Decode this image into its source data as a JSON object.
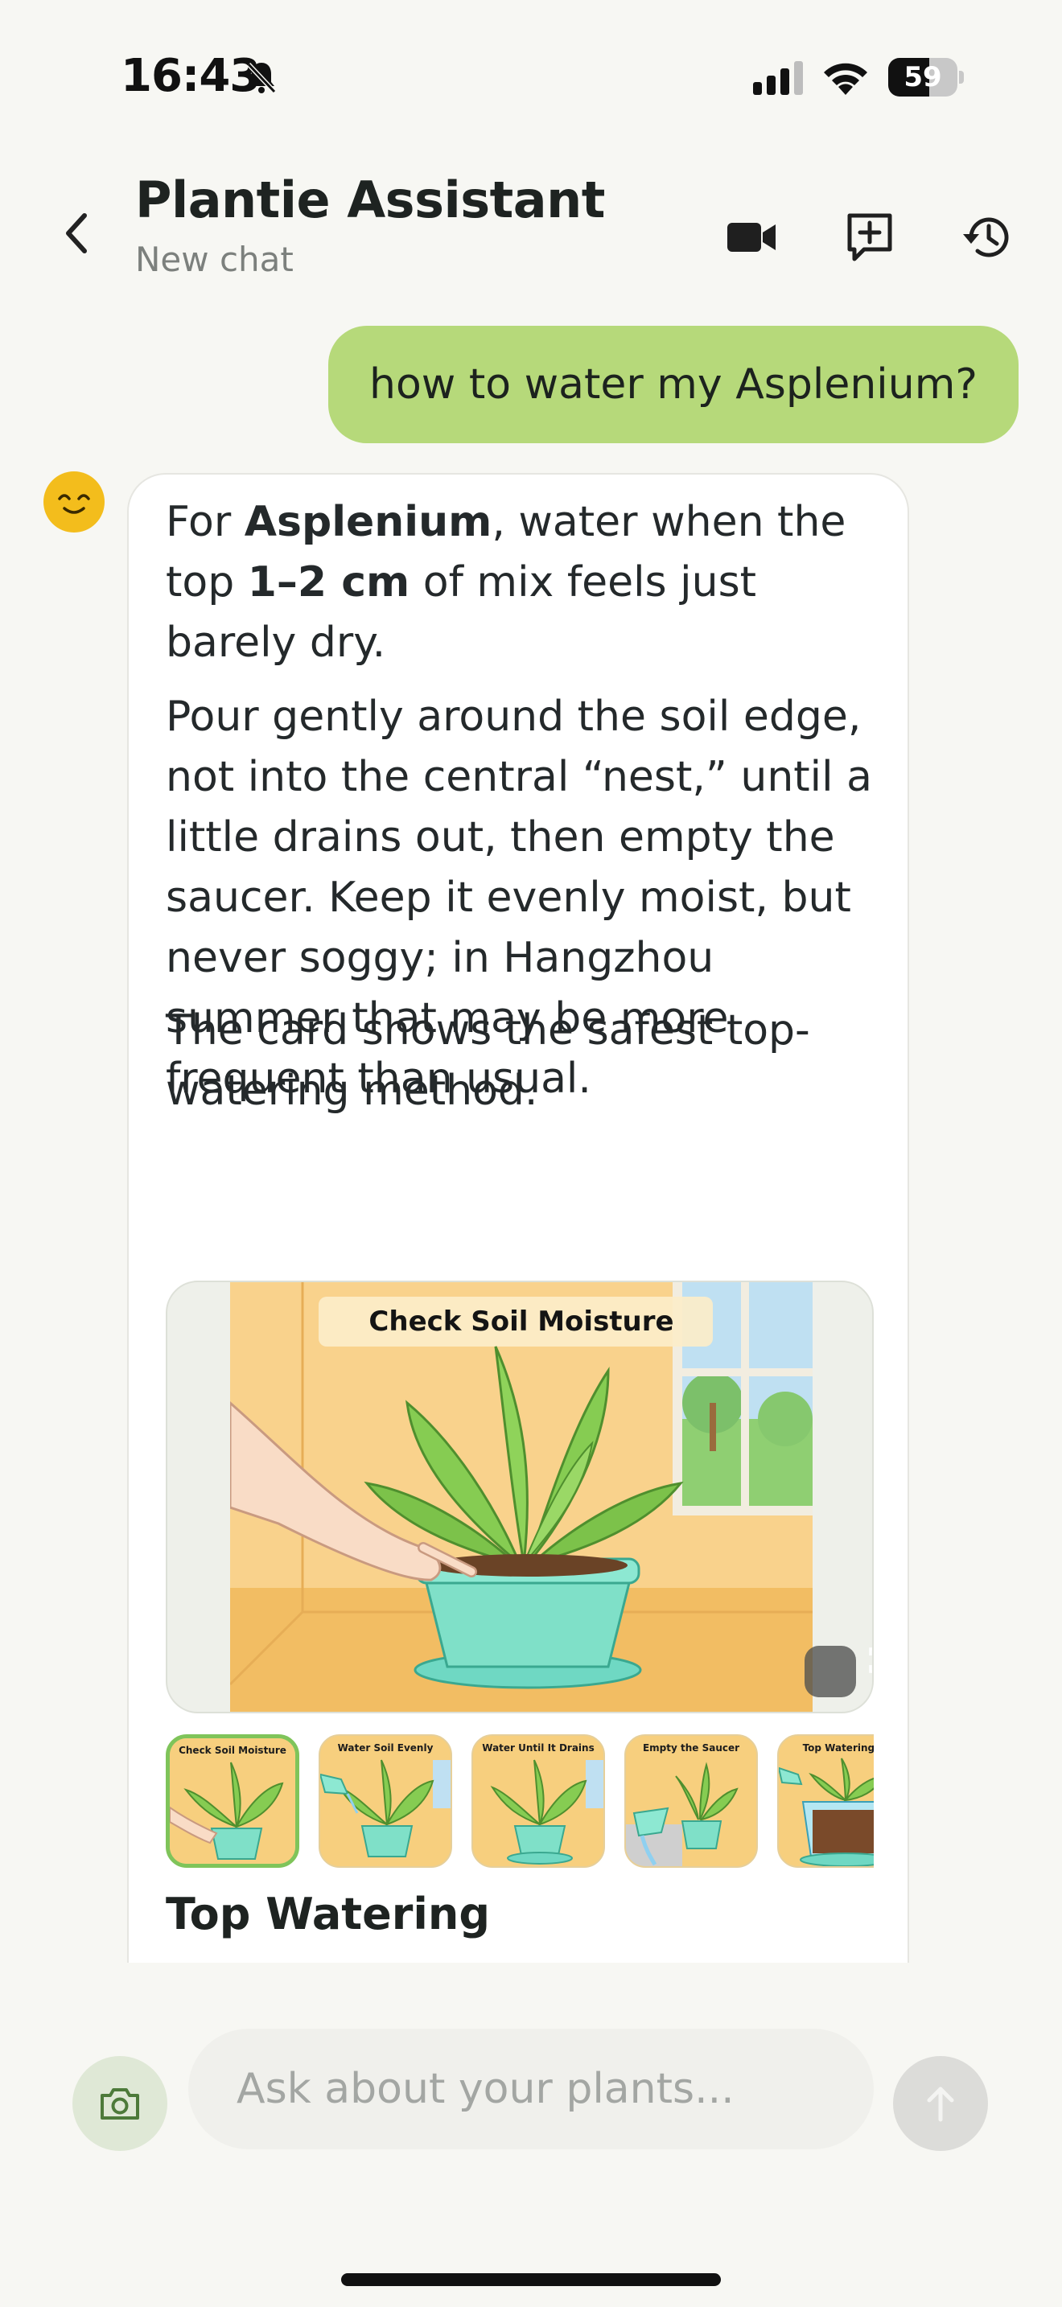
{
  "status": {
    "time": "16:43",
    "battery": "59",
    "battery_level": 0.59
  },
  "header": {
    "title": "Plantie Assistant",
    "subtitle": "New chat"
  },
  "user_message": "how to water my Asplenium?",
  "bot_message": {
    "p1": {
      "t1": "For ",
      "b1": "Asplenium",
      "t2": ", water when the top ",
      "b2": "1–2 cm",
      "t3": " of mix feels just barely dry."
    },
    "p2": "Pour gently around the soil edge, not into the central “nest,” until a little drains out, then empty the saucer. Keep it evenly moist, but never soggy; in Hangzhou summer that may be more frequent than usual.",
    "p3": "The card shows the safest top-watering method.",
    "image_caption": "Check Soil Moisture",
    "thumbnails": [
      "Check Soil Moisture",
      "Water Soil Evenly",
      "Water Until It Drains",
      "Empty the Saucer",
      "Top Watering B"
    ],
    "card_title": "Top Watering"
  },
  "composer": {
    "placeholder": "Ask about your plants..."
  },
  "colors": {
    "accent": "#b6d97a",
    "active_thumb": "#7fc45a",
    "avatar": "#f3bd1c"
  },
  "icons": [
    "bell-off-icon",
    "signal-icon",
    "wifi-icon",
    "back-chevron-icon",
    "video-icon",
    "new-chat-icon",
    "history-icon",
    "smile-icon",
    "expand-icon",
    "camera-icon",
    "arrow-up-icon"
  ]
}
